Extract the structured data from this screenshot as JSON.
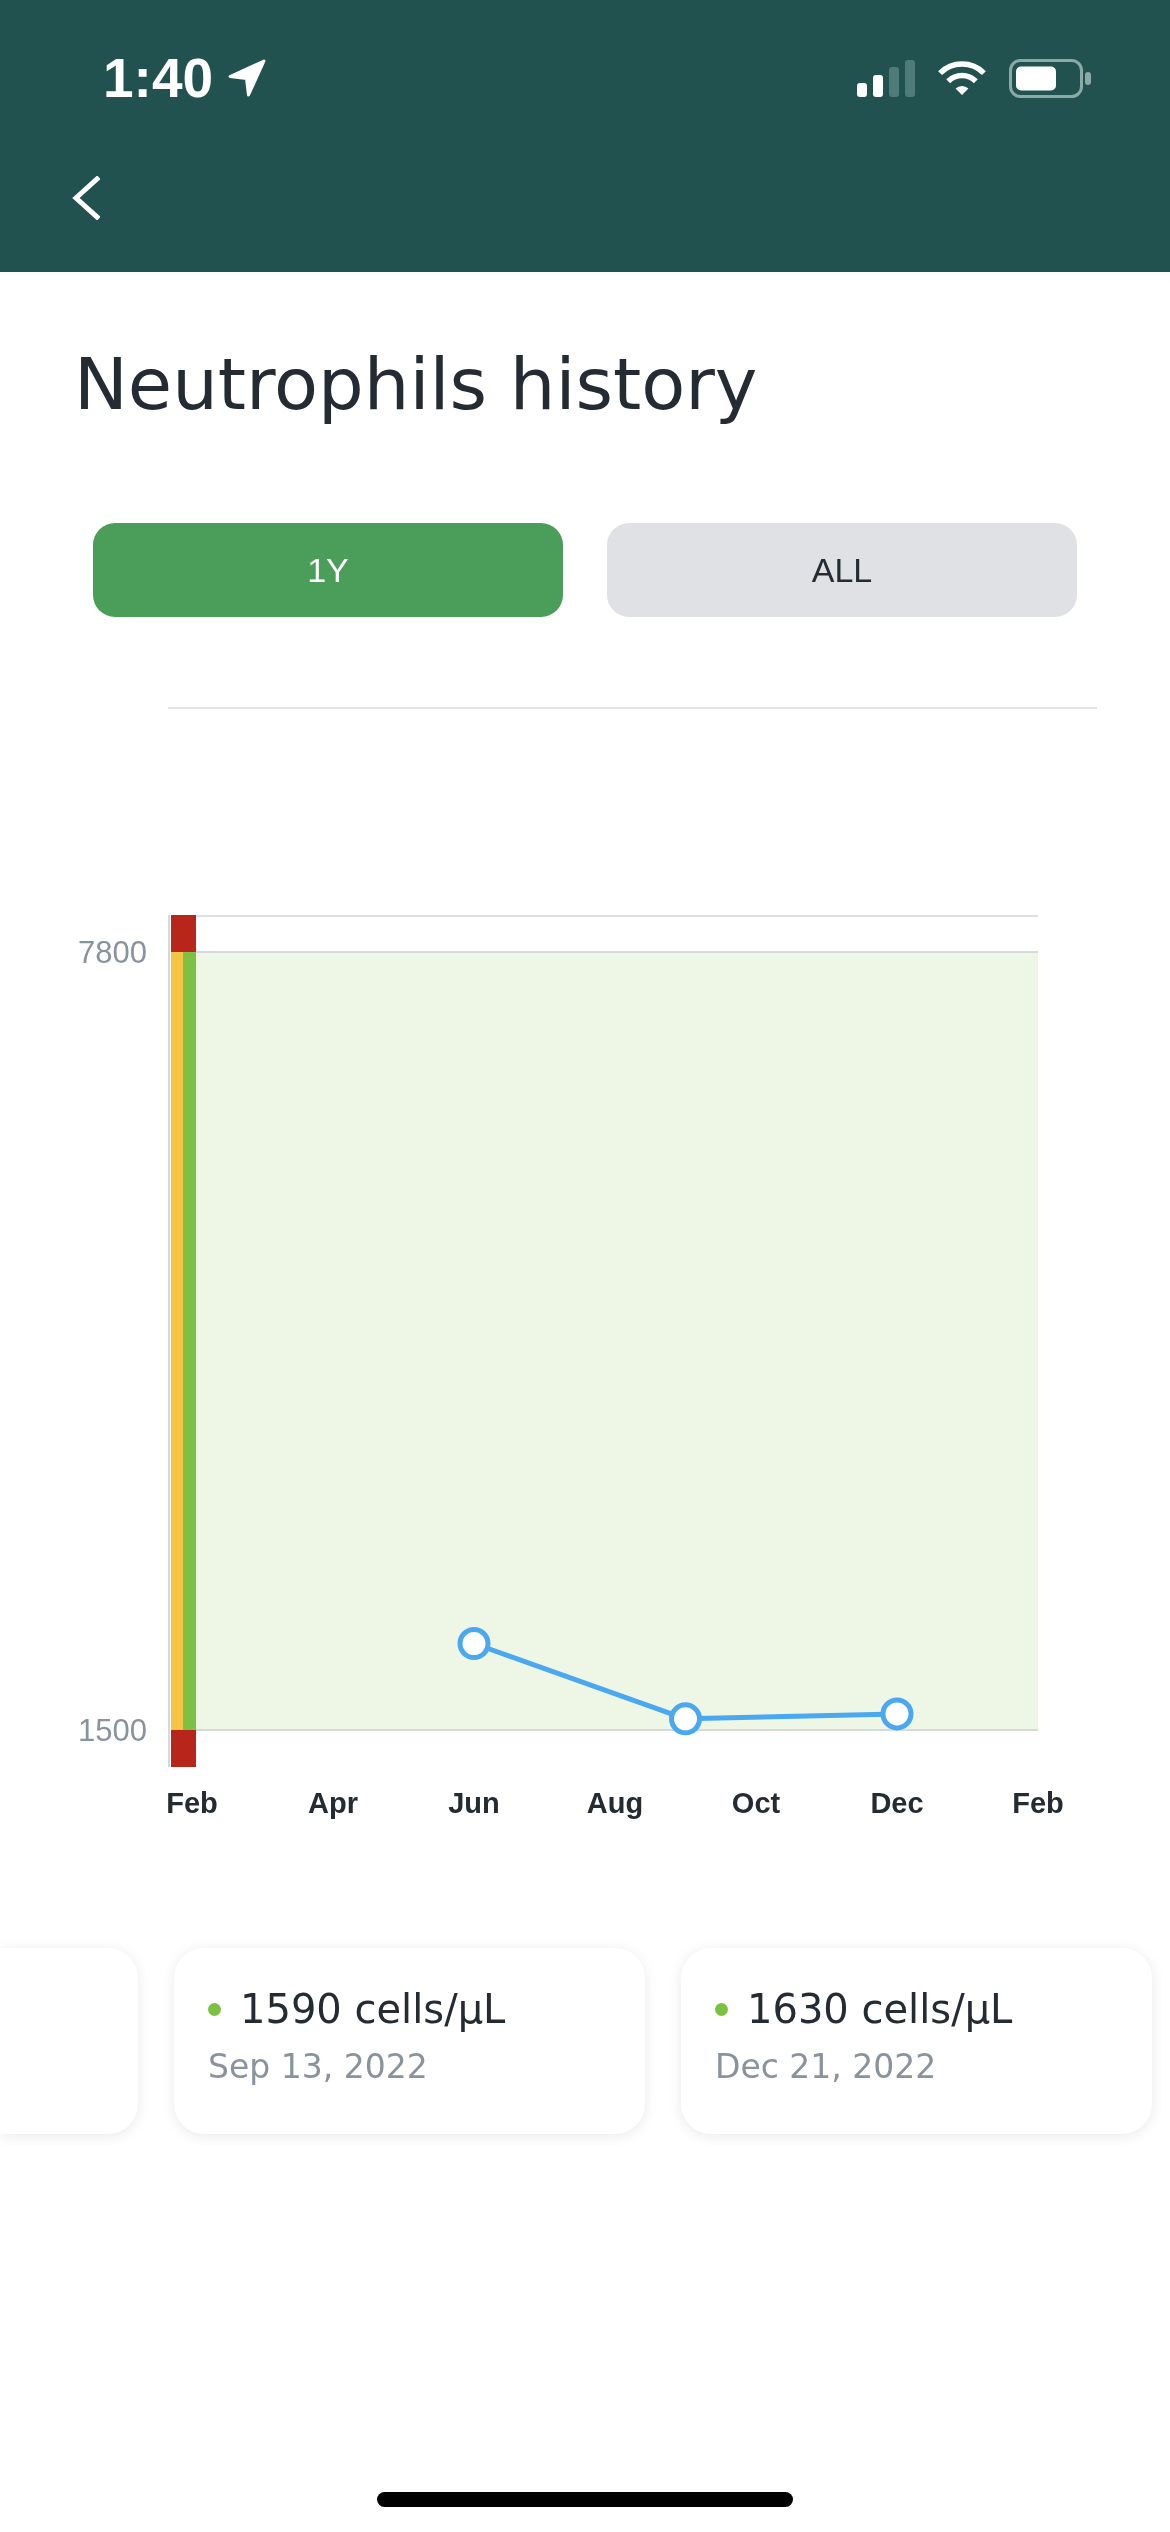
{
  "status_bar": {
    "time": "1:40"
  },
  "title": "Neutrophils history",
  "range_tabs": [
    {
      "label": "1Y",
      "selected": true
    },
    {
      "label": "ALL",
      "selected": false
    }
  ],
  "chart": {
    "chart_data": {
      "type": "line",
      "categories": [
        "Feb",
        null,
        "Apr",
        null,
        "Jun",
        null,
        "Aug",
        null,
        "Oct",
        null,
        "Dec",
        null,
        "Feb"
      ],
      "series": [
        {
          "color": "#4aa8f0",
          "marker": "circle",
          "values": [
            null,
            null,
            null,
            null,
            2200,
            null,
            null,
            1590,
            null,
            null,
            1630,
            null,
            null
          ]
        }
      ],
      "ylim": [
        1200,
        8100
      ],
      "yticks": [
        1500,
        7800
      ]
    }
  },
  "readings": {
    "clipped_left": true,
    "cards": [
      {
        "value": "1590 cells/μL",
        "date": "Sep 13, 2022",
        "color": "#7cc242"
      },
      {
        "value": "1630 cells/μL",
        "date": "Dec 21, 2022",
        "color": "#7cc242"
      }
    ]
  }
}
